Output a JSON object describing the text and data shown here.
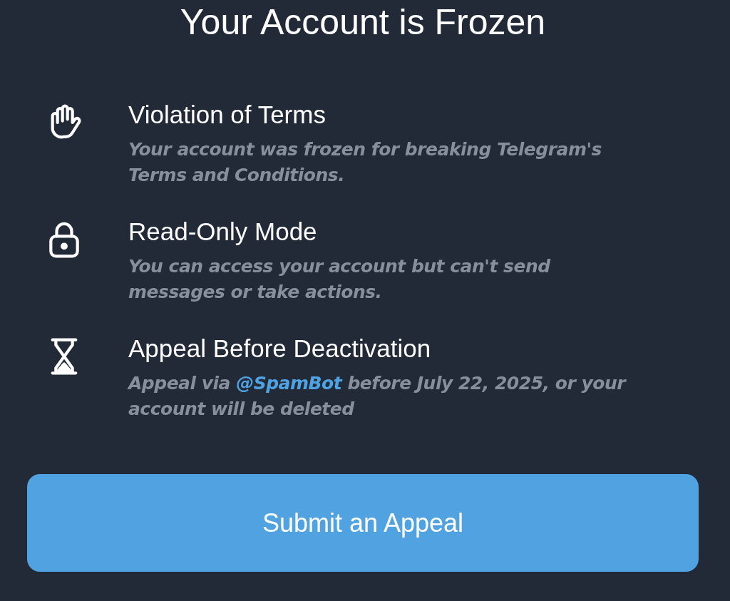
{
  "title": "Your Account is Frozen",
  "items": [
    {
      "kind": "hand",
      "heading": "Violation of Terms",
      "description": [
        {
          "kind": "text",
          "text": "Your account was frozen for breaking Telegram's Terms and Conditions."
        }
      ]
    },
    {
      "kind": "lock",
      "heading": "Read-Only Mode",
      "description": [
        {
          "kind": "text",
          "text": "You can access your account but can't send messages or take actions."
        }
      ]
    },
    {
      "kind": "hourglass",
      "heading": "Appeal Before Deactivation",
      "description": [
        {
          "kind": "text",
          "text": "Appeal via "
        },
        {
          "kind": "link",
          "text": "@SpamBot"
        },
        {
          "kind": "text",
          "text": " before July 22, 2025, or your account will be deleted"
        }
      ]
    }
  ],
  "button": {
    "label": "Submit an Appeal"
  }
}
